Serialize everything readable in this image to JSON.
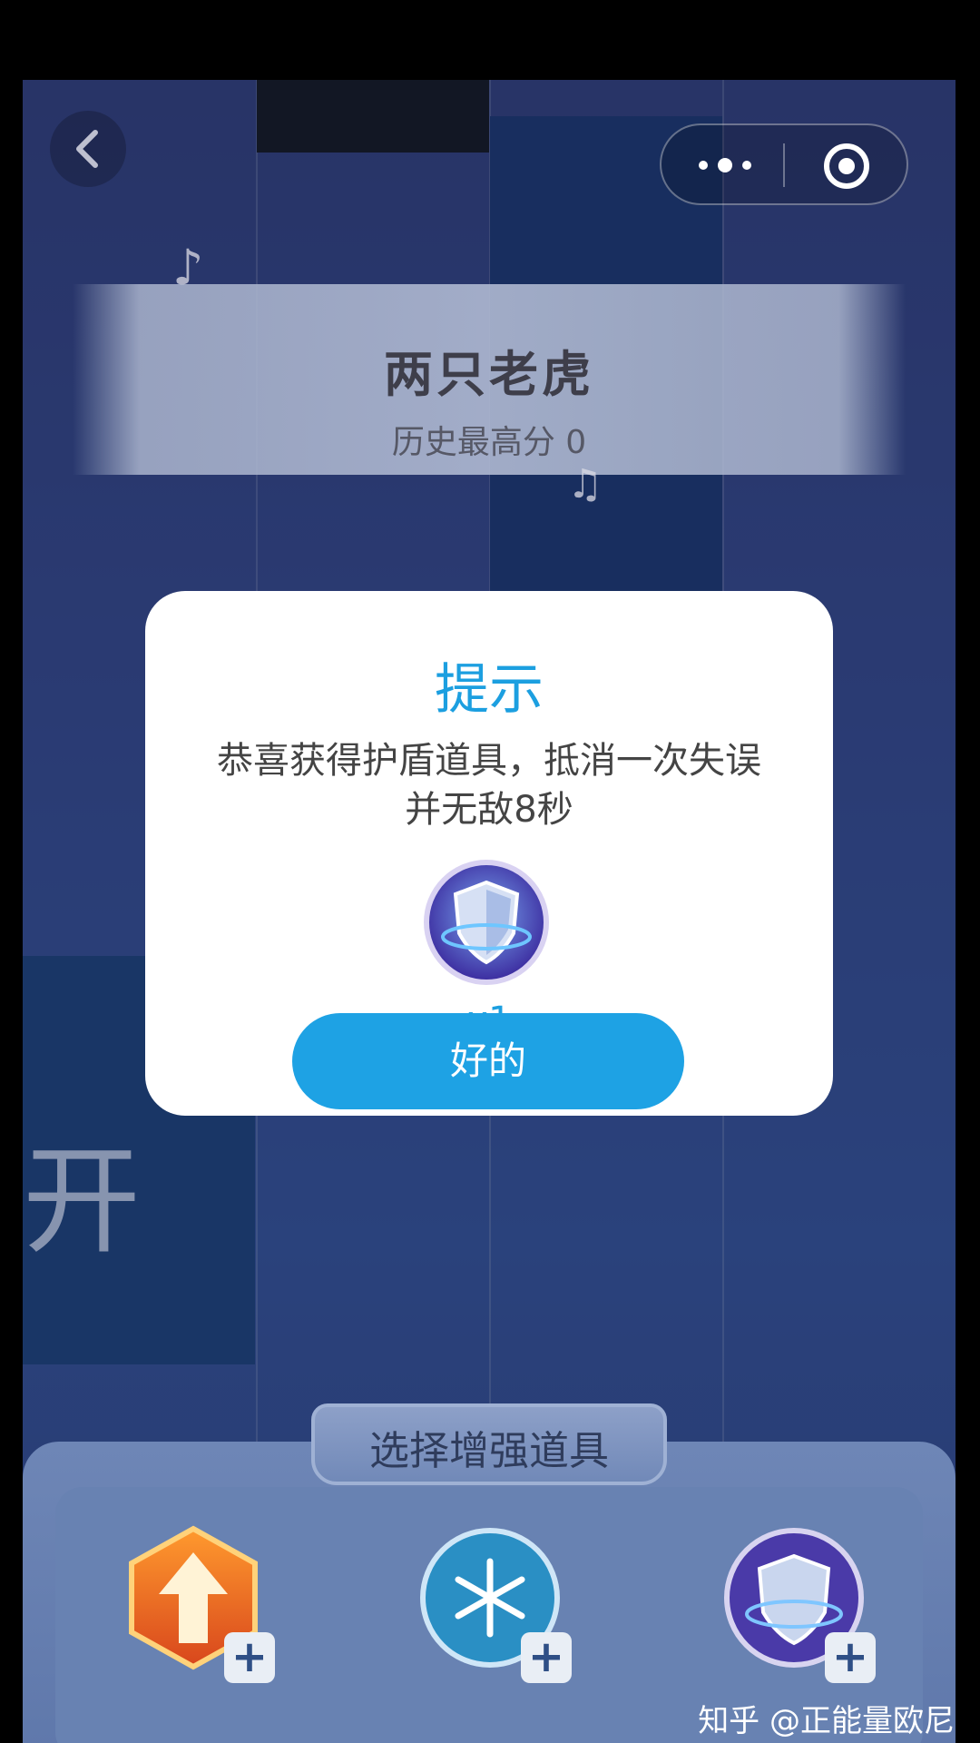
{
  "song": {
    "title": "两只老虎",
    "best_score_text": "历史最高分 0"
  },
  "background": {
    "start_text": "开"
  },
  "dialog": {
    "title": "提示",
    "message": "恭喜获得护盾道具，抵消一次失误并无敌8秒",
    "count_label": "x1",
    "ok_label": "好的",
    "item_icon": "shield-icon"
  },
  "boost_panel": {
    "title": "选择增强道具",
    "items": [
      {
        "icon": "speed-arrow-icon",
        "add_label": "+"
      },
      {
        "icon": "snowflake-icon",
        "add_label": "+"
      },
      {
        "icon": "shield-icon",
        "add_label": "+"
      }
    ]
  },
  "capsule": {
    "menu_icon": "more-dots-icon",
    "close_icon": "target-circle-icon"
  },
  "watermark": "知乎 @正能量欧尼",
  "colors": {
    "accent": "#1ea2e4",
    "panel": "#6882b2",
    "background": "#2d4392"
  }
}
